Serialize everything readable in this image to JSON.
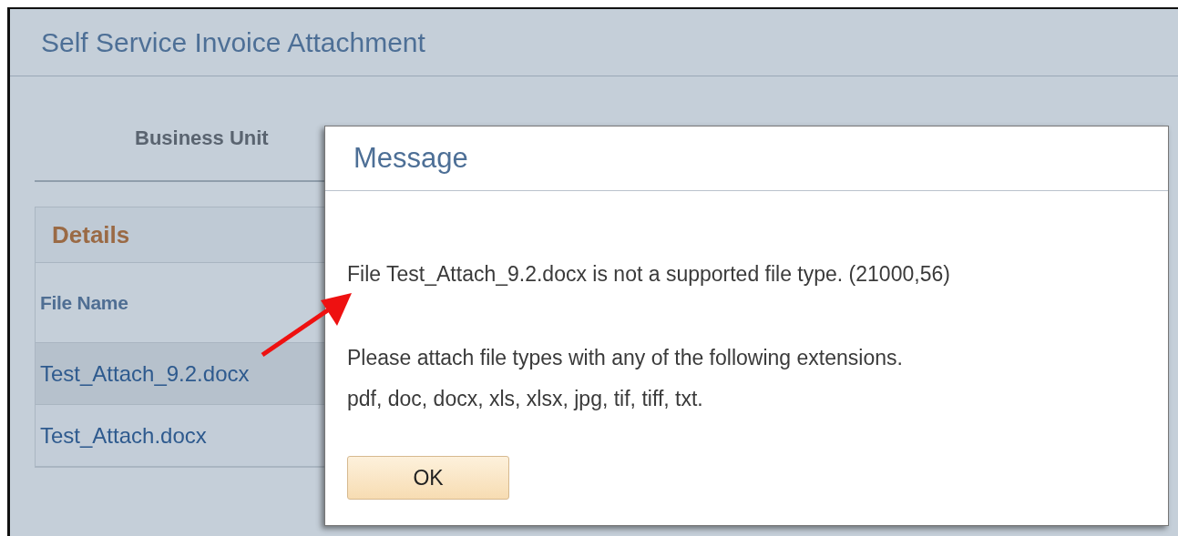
{
  "page": {
    "title": "Self Service Invoice Attachment"
  },
  "business_unit": {
    "label": "Business Unit"
  },
  "details": {
    "title": "Details",
    "columns": [
      "File Name"
    ],
    "rows": [
      {
        "file_name": "Test_Attach_9.2.docx",
        "selected": true
      },
      {
        "file_name": "Test_Attach.docx",
        "selected": false
      }
    ]
  },
  "dialog": {
    "title": "Message",
    "error": "File Test_Attach_9.2.docx is not a supported file type. (21000,56)",
    "lines": [
      "Please attach file types with any of the following extensions.",
      "pdf, doc, docx, xls, xlsx, jpg, tif, tiff, txt."
    ],
    "buttons": [
      "OK"
    ]
  }
}
